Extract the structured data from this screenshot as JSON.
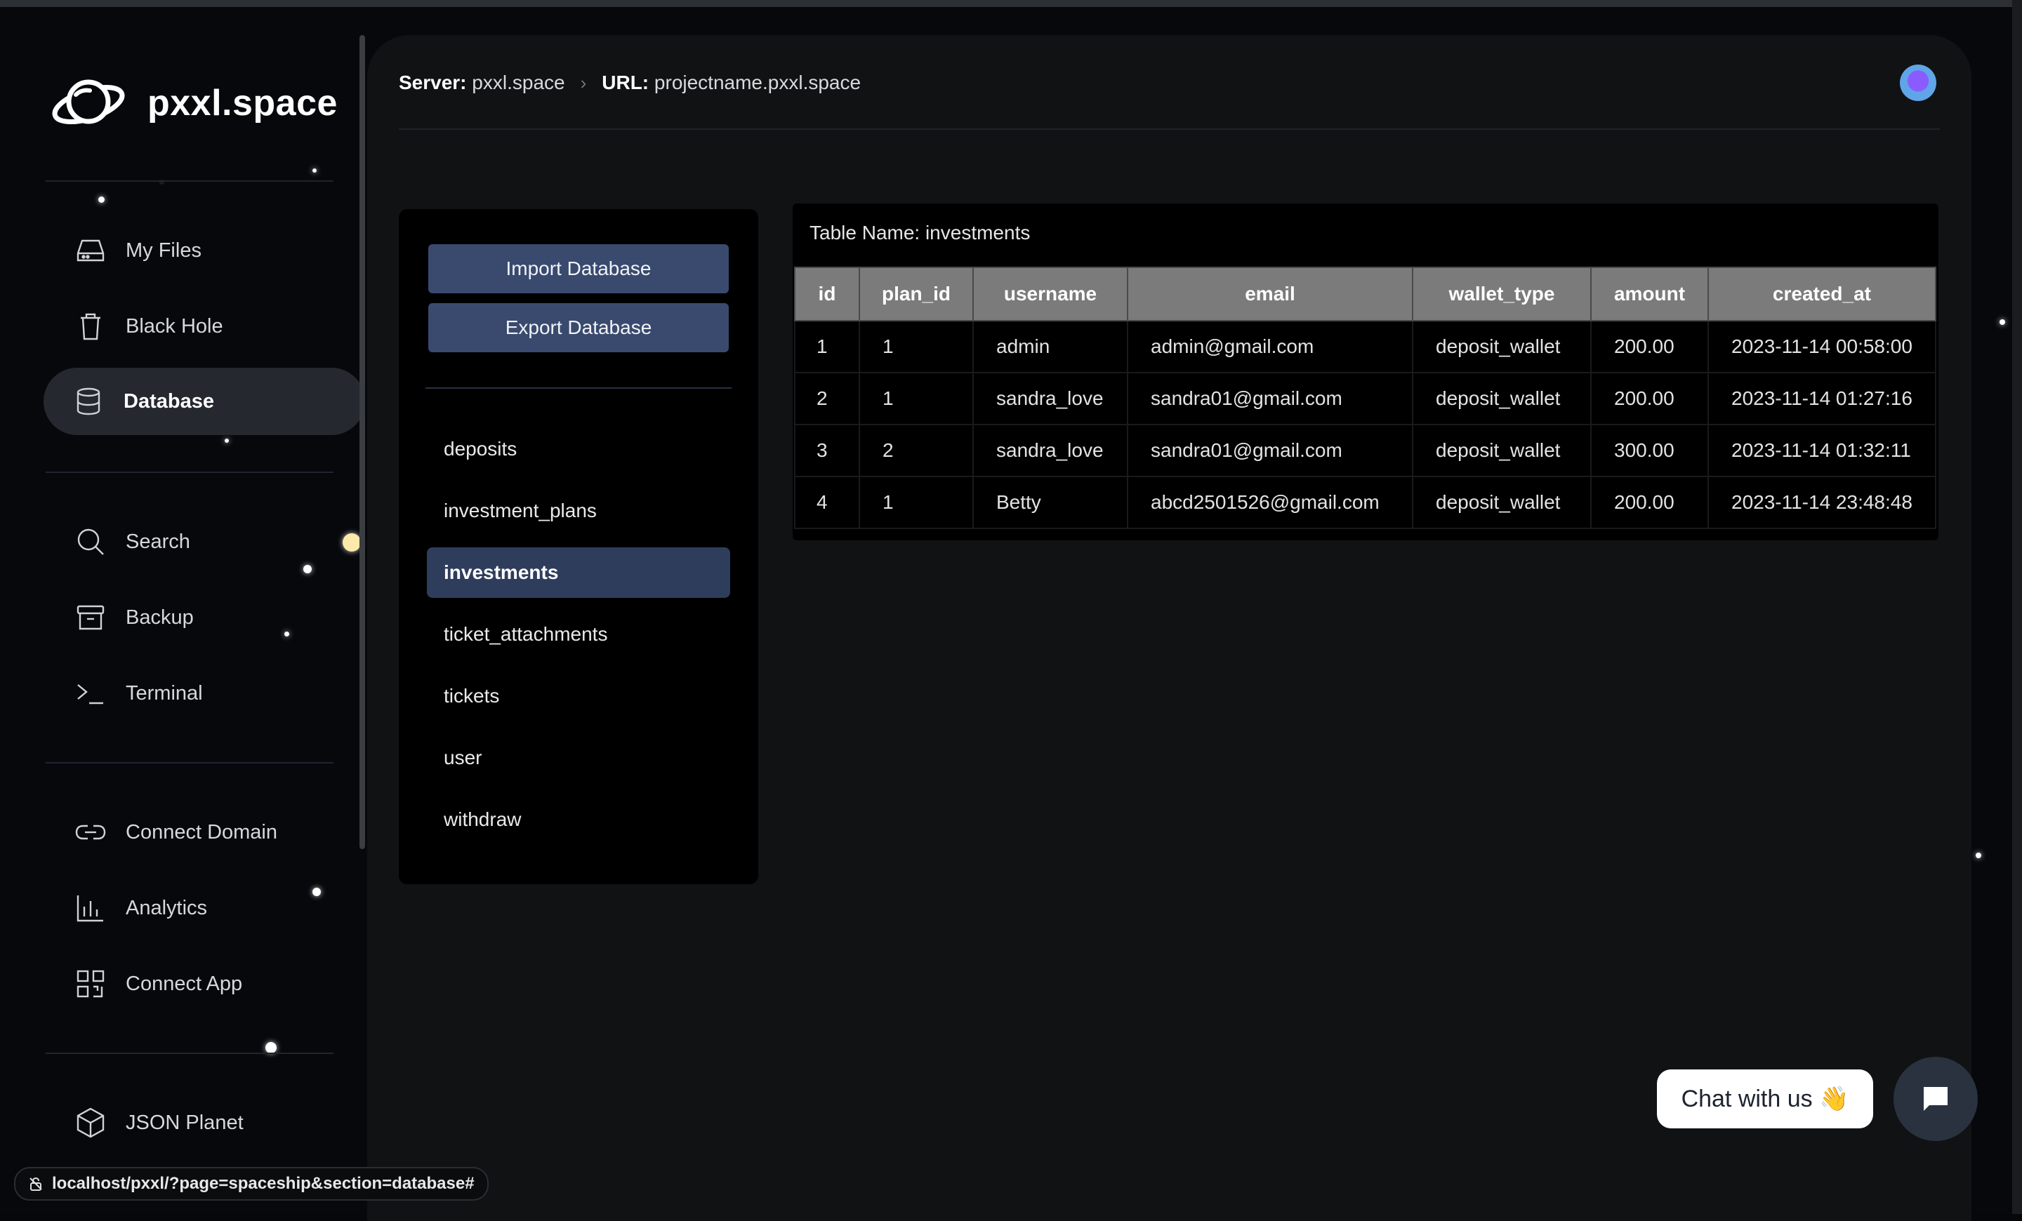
{
  "app": {
    "name": "pxxl.space"
  },
  "sidebar": {
    "items": [
      {
        "label": "My Files",
        "icon": "drive-icon"
      },
      {
        "label": "Black Hole",
        "icon": "trash-icon"
      },
      {
        "label": "Database",
        "icon": "database-icon",
        "active": true
      },
      {
        "label": "Search",
        "icon": "search-icon"
      },
      {
        "label": "Backup",
        "icon": "archive-icon"
      },
      {
        "label": "Terminal",
        "icon": "terminal-icon"
      },
      {
        "label": "Connect Domain",
        "icon": "link-icon"
      },
      {
        "label": "Analytics",
        "icon": "bar-chart-icon"
      },
      {
        "label": "Connect App",
        "icon": "qr-code-icon"
      },
      {
        "label": "JSON Planet",
        "icon": "cube-icon"
      }
    ]
  },
  "header": {
    "server_label": "Server:",
    "server_value": "pxxl.space",
    "url_label": "URL:",
    "url_value": "projectname.pxxl.space"
  },
  "db_panel": {
    "import_label": "Import Database",
    "export_label": "Export Database",
    "tables": [
      "deposits",
      "investment_plans",
      "investments",
      "ticket_attachments",
      "tickets",
      "user",
      "withdraw"
    ],
    "active_table": "investments"
  },
  "table_view": {
    "title": "Table Name: investments",
    "columns": [
      "id",
      "plan_id",
      "username",
      "email",
      "wallet_type",
      "amount",
      "created_at"
    ],
    "rows": [
      [
        "1",
        "1",
        "admin",
        "admin@gmail.com",
        "deposit_wallet",
        "200.00",
        "2023-11-14 00:58:00"
      ],
      [
        "2",
        "1",
        "sandra_love",
        "sandra01@gmail.com",
        "deposit_wallet",
        "200.00",
        "2023-11-14 01:27:16"
      ],
      [
        "3",
        "2",
        "sandra_love",
        "sandra01@gmail.com",
        "deposit_wallet",
        "300.00",
        "2023-11-14 01:32:11"
      ],
      [
        "4",
        "1",
        "Betty",
        "abcd2501526@gmail.com",
        "deposit_wallet",
        "200.00",
        "2023-11-14 23:48:48"
      ]
    ]
  },
  "chat": {
    "label": "Chat with us 👋"
  },
  "status_bar": {
    "url": "localhost/pxxl/?page=spaceship&section=database#"
  },
  "colors": {
    "accent": "#394a6e",
    "active_table": "#2f3d5c",
    "header_cell": "#7b7b7b"
  }
}
